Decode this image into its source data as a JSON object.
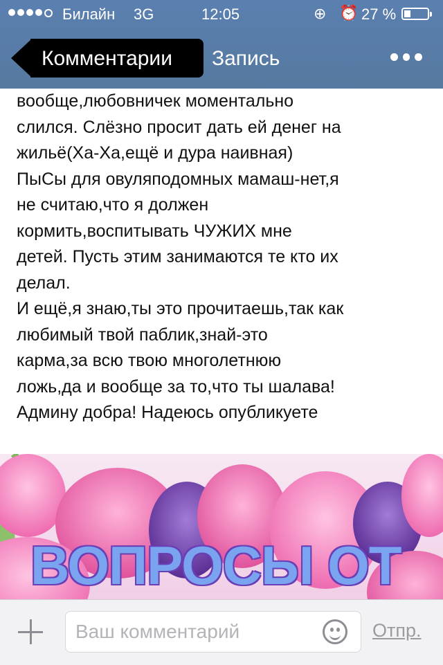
{
  "status_bar": {
    "carrier": "Билайн",
    "network": "3G",
    "time": "12:05",
    "battery_percent": "27 %",
    "battery_level": 0.27,
    "icons": [
      "signal-dots-icon",
      "orientation-lock-icon",
      "alarm-icon",
      "battery-icon"
    ]
  },
  "nav": {
    "back_label": "Комментарии",
    "title": "Запись",
    "more_icon": "more-dots-icon"
  },
  "post": {
    "lines": [
      "вообще,любовничек моментально",
      "слился. Слёзно просит дать ей денег на",
      "жильё(Ха-Ха,ещё и дура наивная)",
      "ПыСы для овуляподомных мамаш-нет,я",
      "не считаю,что я должен",
      "кормить,воспитывать ЧУЖИХ мне",
      "детей. Пусть этим занимаются те кто их",
      "делал.",
      "И ещё,я знаю,ты это прочитаешь,так как",
      "любимый твой паблик,знай-это",
      "карма,за всю твою многолетнюю",
      "ложь,да и вообще за то,что ты шалава!",
      "Админу добра! Надеюсь опубликуете"
    ]
  },
  "image": {
    "caption": "ВОПРОСЫ ОТ"
  },
  "comment_bar": {
    "placeholder": "Ваш комментарий",
    "send_label": "Отпр.",
    "icons": [
      "plus-icon",
      "smile-icon"
    ]
  },
  "colors": {
    "header": "#5b80b0",
    "back_button_bg": "#000000",
    "text": "#111111",
    "caption": "#7aa3f0"
  }
}
